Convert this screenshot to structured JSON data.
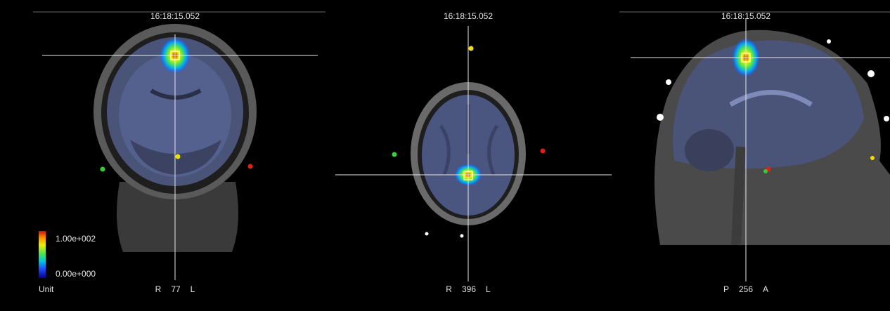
{
  "panes": {
    "coronal": {
      "timestamp": "16:18:15.052",
      "orient_left": "R",
      "slice": "77",
      "orient_right": "L"
    },
    "axial": {
      "timestamp": "16:18:15.052",
      "orient_left": "R",
      "slice": "396",
      "orient_right": "L"
    },
    "sagittal": {
      "timestamp": "16:18:15.052",
      "orient_left": "P",
      "slice": "256",
      "orient_right": "A"
    }
  },
  "colorbar": {
    "max_label": "1.00e+002",
    "min_label": "0.00e+000",
    "unit_label": "Unit",
    "colors": [
      "#c81400",
      "#ff8c00",
      "#f0f000",
      "#50e650",
      "#00c8dc",
      "#1e50ff",
      "#000096"
    ]
  },
  "colors": {
    "crosshair": "#e8e8e8",
    "cursor_box": "#ffff96",
    "marker_yellow": "#f0e000",
    "marker_green": "#30d030",
    "marker_red": "#e02010",
    "marker_white": "#ffffff"
  }
}
